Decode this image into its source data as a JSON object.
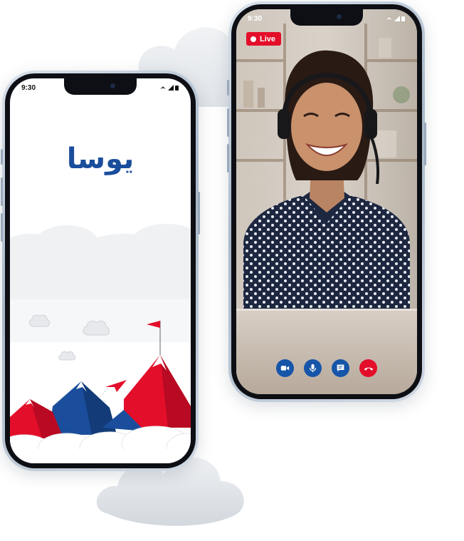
{
  "colors": {
    "brand_blue": "#1a4e9c",
    "brand_red": "#e30e2a",
    "call_button_blue": "#1655a8"
  },
  "splash_phone": {
    "status_time": "9:30",
    "logo_text": "يوسا"
  },
  "call_phone": {
    "status_time": "9:30",
    "live_label": "Live",
    "controls": [
      {
        "icon": "video-camera-icon"
      },
      {
        "icon": "microphone-icon"
      },
      {
        "icon": "chat-icon"
      },
      {
        "icon": "end-call-icon"
      }
    ]
  }
}
